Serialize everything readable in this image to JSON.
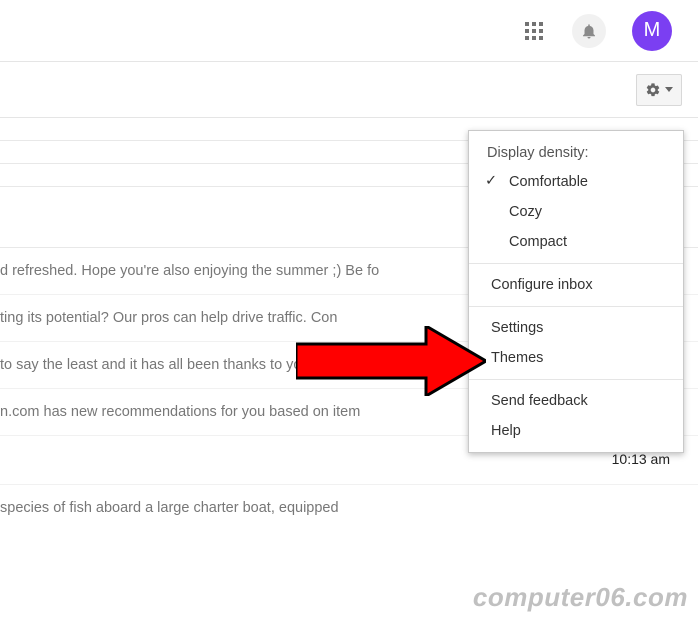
{
  "header": {
    "avatar_initial": "M"
  },
  "dropdown": {
    "header": "Display density:",
    "density": {
      "comfortable": "Comfortable",
      "cozy": "Cozy",
      "compact": "Compact"
    },
    "configure_inbox": "Configure inbox",
    "settings": "Settings",
    "themes": "Themes",
    "send_feedback": "Send feedback",
    "help": "Help"
  },
  "messages": {
    "row1": "d refreshed. Hope you're also enjoying the summer ;) Be fo",
    "row2": "ting its potential? Our pros can help drive traffic. Con",
    "row3": "to say the least and it has all been thanks to you, our bea",
    "row4": "n.com has new recommendations for you based on item",
    "row5_time": "10:13 am",
    "row6": "species of fish aboard a large charter boat, equipped"
  },
  "watermark": "computer06.com"
}
